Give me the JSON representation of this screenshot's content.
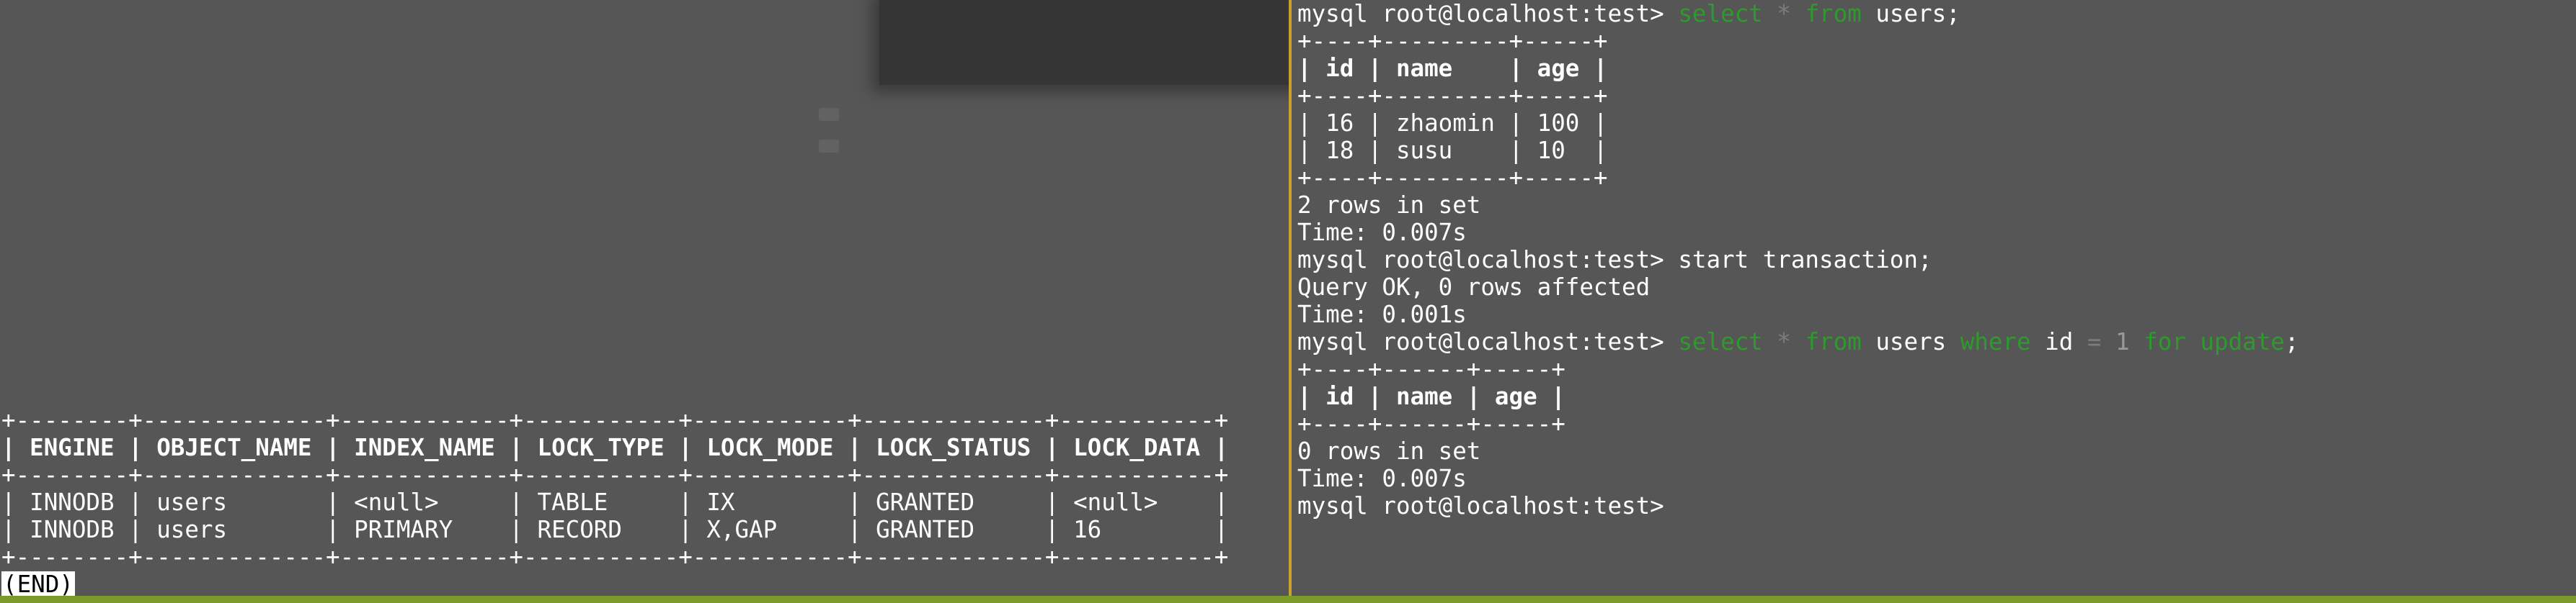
{
  "left_pane": {
    "table": {
      "border_line": "+--------+-------------+------------+-----------+-----------+-------------+-----------+",
      "header_row": "| ENGINE | OBJECT_NAME | INDEX_NAME | LOCK_TYPE | LOCK_MODE | LOCK_STATUS | LOCK_DATA |",
      "rows": [
        "| INNODB | users       | <null>     | TABLE     | IX        | GRANTED     | <null>    |",
        "| INNODB | users       | PRIMARY    | RECORD    | X,GAP     | GRANTED     | 16        |"
      ]
    },
    "pager_end": "(END)"
  },
  "right_pane": {
    "prompt": "mysql root@localhost:test>",
    "cmd1": {
      "kw_select": "select",
      "op_star": "*",
      "kw_from": "from",
      "table": "users",
      "semicolon": ";"
    },
    "result1": {
      "border": "+----+---------+-----+",
      "header": "| id | name    | age |",
      "rows": [
        "| 16 | zhaomin | 100 |",
        "| 18 | susu    | 10  |"
      ],
      "rows_info": "2 rows in set",
      "time": "Time: 0.007s"
    },
    "cmd2": "start transaction;",
    "result2": {
      "query_ok": "Query OK, 0 rows affected",
      "time": "Time: 0.001s"
    },
    "cmd3": {
      "kw_select": "select",
      "op_star": "*",
      "kw_from": "from",
      "table": "users",
      "kw_where": "where",
      "col": "id",
      "op_eq": "=",
      "num": "1",
      "kw_for_update": "for update",
      "semicolon": ";"
    },
    "result3": {
      "border": "+----+------+-----+",
      "header": "| id | name | age |",
      "rows_info": "0 rows in set",
      "time": "Time: 0.007s"
    }
  },
  "colors": {
    "background": "#565656",
    "text": "#ffffff",
    "keyword": "#2e9a2e",
    "divider": "#c9a227",
    "statusbar": "#7a9a2a"
  }
}
